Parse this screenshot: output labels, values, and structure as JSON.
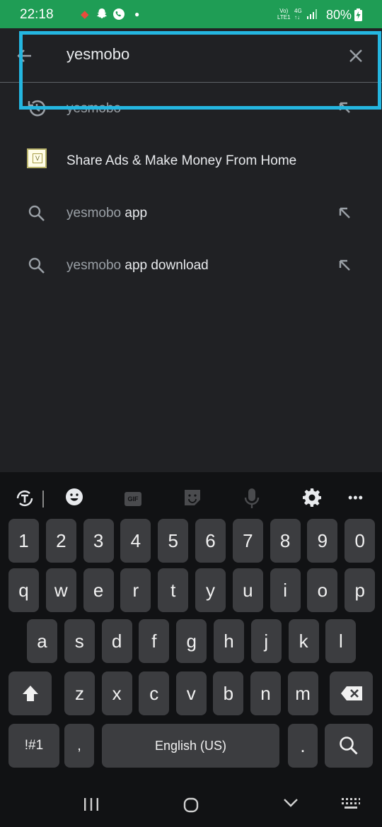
{
  "status_bar": {
    "time": "22:18",
    "network_top": "Vo)",
    "network_bottom": "LTE1",
    "network_type": "4G",
    "battery_percent": "80%"
  },
  "search": {
    "query": "yesmobo"
  },
  "suggestions": [
    {
      "type": "history",
      "prefix": "yesmobo",
      "suffix": ""
    },
    {
      "type": "app",
      "prefix": "",
      "suffix": "Share Ads & Make Money From Home"
    },
    {
      "type": "search",
      "prefix": "yesmobo",
      "suffix": " app"
    },
    {
      "type": "search",
      "prefix": "yesmobo",
      "suffix": " app download"
    }
  ],
  "keyboard": {
    "number_row": [
      "1",
      "2",
      "3",
      "4",
      "5",
      "6",
      "7",
      "8",
      "9",
      "0"
    ],
    "row1": [
      "q",
      "w",
      "e",
      "r",
      "t",
      "y",
      "u",
      "i",
      "o",
      "p"
    ],
    "row2": [
      "a",
      "s",
      "d",
      "f",
      "g",
      "h",
      "j",
      "k",
      "l"
    ],
    "row3": [
      "z",
      "x",
      "c",
      "v",
      "b",
      "n",
      "m"
    ],
    "symbols_key": "!#1",
    "comma_key": ",",
    "space_label": "English (US)",
    "period_key": ".",
    "gif_label": "GIF"
  },
  "colors": {
    "status_bar": "#1f9d55",
    "background": "#202124",
    "highlight": "#24b6e0",
    "key": "#3c3d40",
    "keyboard_bg": "#111214"
  }
}
